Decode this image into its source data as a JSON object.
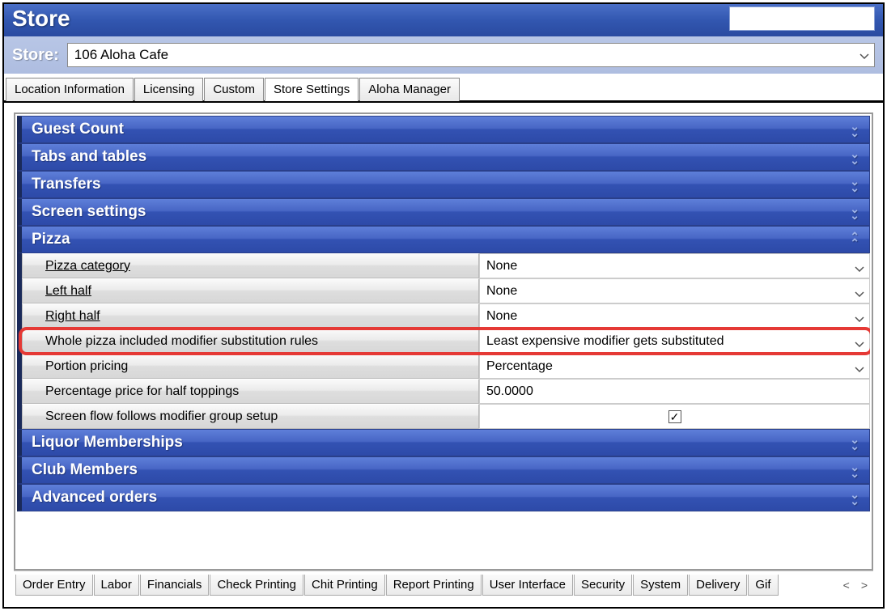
{
  "title": "Store",
  "store_label": "Store:",
  "store_value": "106 Aloha Cafe",
  "top_tabs": [
    "Location Information",
    "Licensing",
    "Custom",
    "Store Settings",
    "Aloha Manager"
  ],
  "top_tab_active_index": 3,
  "sections": {
    "guest_count": "Guest Count",
    "tabs_tables": "Tabs and tables",
    "transfers": "Transfers",
    "screen_settings": "Screen settings",
    "pizza": "Pizza",
    "liquor_memberships": "Liquor Memberships",
    "club_members": "Club Members",
    "advanced_orders": "Advanced orders"
  },
  "pizza_rows": {
    "pizza_category": {
      "label": "Pizza category",
      "value": "None"
    },
    "left_half": {
      "label": "Left half",
      "value": "None"
    },
    "right_half": {
      "label": "Right half",
      "value": "None"
    },
    "sub_rules": {
      "label": "Whole pizza included modifier substitution rules",
      "value": "Least expensive modifier gets substituted"
    },
    "portion_pricing": {
      "label": "Portion pricing",
      "value": "Percentage"
    },
    "pct_half": {
      "label": "Percentage price for half toppings",
      "value": "50.0000"
    },
    "screen_flow": {
      "label": "Screen flow follows modifier group setup",
      "checked": true
    }
  },
  "bottom_tabs": [
    "Order Entry",
    "Labor",
    "Financials",
    "Check Printing",
    "Chit Printing",
    "Report Printing",
    "User Interface",
    "Security",
    "System",
    "Delivery",
    "Gif"
  ]
}
